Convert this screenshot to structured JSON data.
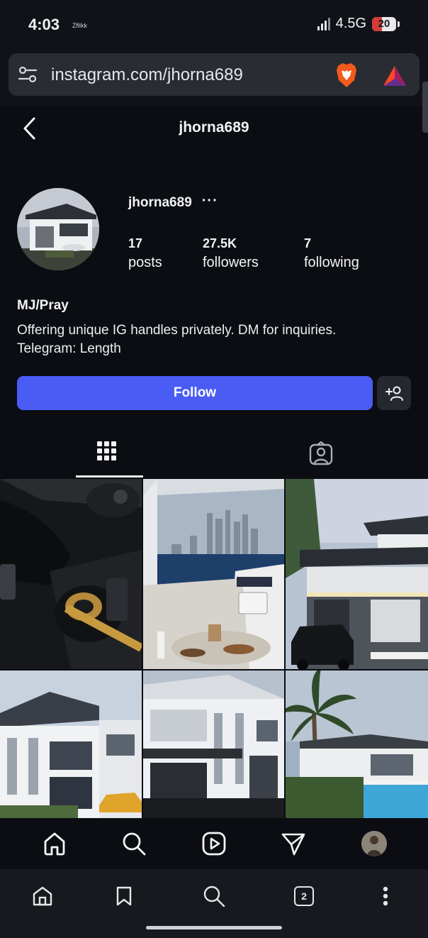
{
  "status_bar": {
    "time": "4:03",
    "carrier_tag": "Zflikk",
    "network": "4.5G",
    "battery": "20"
  },
  "browser": {
    "url": "instagram.com/jhorna689",
    "tab_count": "2"
  },
  "header": {
    "title": "jhorna689"
  },
  "profile": {
    "username": "jhorna689",
    "more": "···",
    "stats": [
      {
        "value": "17",
        "label": "posts"
      },
      {
        "value": "27.5K",
        "label": "followers"
      },
      {
        "value": "7",
        "label": "following"
      }
    ],
    "full_name": "MJ/Pray",
    "bio_line1": "Offering unique IG handles privately. DM for inquiries.",
    "bio_line2": "Telegram: Length",
    "follow_label": "Follow"
  },
  "tabs": [
    {
      "name": "posts-grid",
      "icon": "grid-icon",
      "active": true
    },
    {
      "name": "tagged",
      "icon": "tagged-person-icon",
      "active": false
    }
  ],
  "posts": [
    {
      "icon": "car-interior-cigar-photo"
    },
    {
      "icon": "yacht-city-skyline-photo"
    },
    {
      "icon": "modern-house-suv-photo"
    },
    {
      "icon": "white-villa-photo"
    },
    {
      "icon": "white-villa-night-photo"
    },
    {
      "icon": "palm-tree-pool-house-photo"
    }
  ],
  "ig_nav": [
    "home-icon",
    "search-icon",
    "reels-icon",
    "direct-icon",
    "profile-avatar"
  ],
  "browser_nav": [
    "home-icon",
    "bookmark-icon",
    "search-icon",
    "tabs-icon",
    "menu-icon"
  ],
  "colors": {
    "background": "#0b0d12",
    "follow_button": "#4a5cf4",
    "surface": "#262830"
  }
}
